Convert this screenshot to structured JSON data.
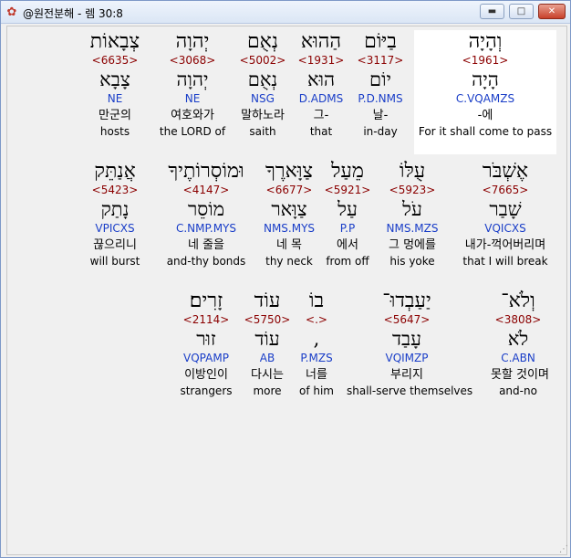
{
  "window": {
    "title": "@원전분해 - 렘 30:8",
    "minimize_icon": "minimize-icon",
    "maximize_icon": "maximize-icon",
    "close_icon": "close-icon"
  },
  "rows": [
    {
      "words": [
        {
          "heb": "וְהָיָה",
          "strong": "<1961>",
          "lex": "הָיָה",
          "parse": "C.VQAMZS",
          "kor": "-에",
          "eng": "For it shall come to pass",
          "highlight": true
        },
        {
          "heb": "בַיּוֹם",
          "strong": "<3117>",
          "lex": "יוֹם",
          "parse": "P.D.NMS",
          "kor": "날-",
          "eng": "in-day"
        },
        {
          "heb": "הַהוּא",
          "strong": "<1931>",
          "lex": "הוּא",
          "parse": "D.ADMS",
          "kor": "그-",
          "eng": "that"
        },
        {
          "heb": "נְאֻם",
          "strong": "<5002>",
          "lex": "נְאֻם",
          "parse": "NSG",
          "kor": "말하노라",
          "eng": "saith"
        },
        {
          "heb": "יְהוָה",
          "strong": "<3068>",
          "lex": "יְהוָה",
          "parse": "NE",
          "kor": "여호와가",
          "eng": "the LORD of"
        },
        {
          "heb": "צְבָאוֹת",
          "strong": "<6635>",
          "lex": "צָבָא",
          "parse": "NE",
          "kor": "만군의",
          "eng": "hosts"
        }
      ]
    },
    {
      "words": [
        {
          "heb": "אֶשְׁבֹּר",
          "strong": "<7665>",
          "lex": "שָׁבַר",
          "parse": "VQICXS",
          "kor": "내가-꺽어버리며",
          "eng": "that I will break"
        },
        {
          "heb": "עֻלּוֹ",
          "strong": "<5923>",
          "lex": "עֹל",
          "parse": "NMS.MZS",
          "kor": "그 멍에를",
          "eng": "his yoke"
        },
        {
          "heb": "מֵעַל",
          "strong": "<5921>",
          "lex": "עַל",
          "parse": "P.P",
          "kor": "에서",
          "eng": "from off"
        },
        {
          "heb": "צַוָּארֶךָ",
          "strong": "<6677>",
          "lex": "צַוָּאר",
          "parse": "NMS.MYS",
          "kor": "네 목",
          "eng": "thy neck"
        },
        {
          "heb": "וּמוֹסְרוֹתֶיךָ",
          "strong": "<4147>",
          "lex": "מוֹסֵר",
          "parse": "C.NMP.MYS",
          "kor": "네 줄을",
          "eng": "and-thy bonds"
        },
        {
          "heb": "אֲנַתֵּק",
          "strong": "<5423>",
          "lex": "נָתַק",
          "parse": "VPICXS",
          "kor": "끊으리니",
          "eng": "will burst"
        }
      ]
    },
    {
      "words": [
        {
          "heb": "וְלֹא־",
          "strong": "<3808>",
          "lex": "לֹא",
          "parse": "C.ABN",
          "kor": "못할 것이며",
          "eng": "and-no"
        },
        {
          "heb": "יַעַבְדוּ־",
          "strong": "<5647>",
          "lex": "עָבַד",
          "parse": "VQIMZP",
          "kor": "부리지",
          "eng": "shall-serve themselves"
        },
        {
          "heb": "בוֹ",
          "strong": "<.>",
          "lex": ",",
          "parse": "P.MZS",
          "kor": "너를",
          "eng": "of him"
        },
        {
          "heb": "עוֹד",
          "strong": "<5750>",
          "lex": "עוֹד",
          "parse": "AB",
          "kor": "다시는",
          "eng": "more"
        },
        {
          "heb": "זָרִים׃",
          "strong": "<2114>",
          "lex": "זוּר",
          "parse": "VQPAMP",
          "kor": "이방인이",
          "eng": "strangers"
        }
      ]
    }
  ]
}
